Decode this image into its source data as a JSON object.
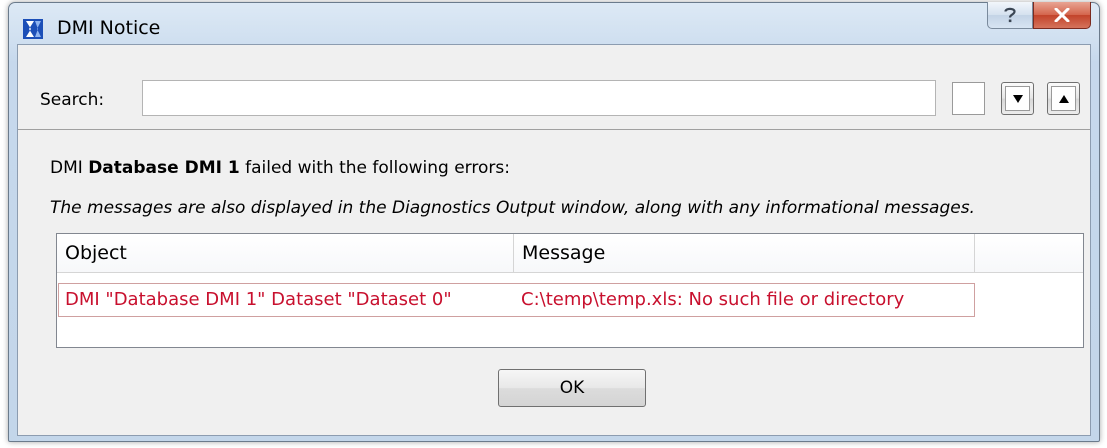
{
  "window": {
    "title": "DMI Notice",
    "app_icon": "riverware-logo-icon",
    "caption_buttons": [
      "help-icon",
      "close-icon"
    ]
  },
  "search": {
    "label": "Search:",
    "value": "",
    "match_case_checked": false,
    "next_icon": "triangle-down-icon",
    "prev_icon": "triangle-up-icon"
  },
  "message": {
    "prefix": "DMI ",
    "dmi_name": "Database DMI 1",
    "suffix": " failed with the following errors:",
    "note": "The messages are also displayed in the Diagnostics Output window, along with any informational messages."
  },
  "table": {
    "columns": [
      "Object",
      "Message"
    ],
    "rows": [
      {
        "object": "DMI \"Database DMI 1\" Dataset \"Dataset 0\"",
        "message": "C:\\temp\\temp.xls: No such file or directory"
      }
    ]
  },
  "buttons": {
    "ok_label": "OK"
  },
  "colors": {
    "error_text": "#c8102e",
    "close_button": "#c8452f"
  }
}
